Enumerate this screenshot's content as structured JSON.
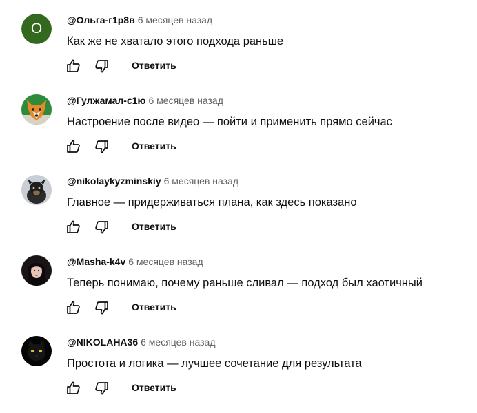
{
  "comments": [
    {
      "author": "@Ольга-г1р8в",
      "time": "6 месяцев назад",
      "text": "Как же не хватало этого подхода раньше",
      "avatar_letter": "О",
      "avatar_color": "#33691e",
      "reply_label": "Ответить"
    },
    {
      "author": "@Гулжамал-с1ю",
      "time": "6 месяцев назад",
      "text": "Настроение после видео — пойти и применить прямо сейчас",
      "reply_label": "Ответить"
    },
    {
      "author": "@nikolaykyzminskiy",
      "time": "6 месяцев назад",
      "text": "Главное — придерживаться плана, как здесь показано",
      "reply_label": "Ответить"
    },
    {
      "author": "@Masha-k4v",
      "time": "6 месяцев назад",
      "text": "Теперь понимаю, почему раньше сливал — подход был хаотичный",
      "reply_label": "Ответить"
    },
    {
      "author": "@NIKOLAHA36",
      "time": "6 месяцев назад",
      "text": "Простота и логика — лучшее сочетание для результата",
      "reply_label": "Ответить"
    }
  ],
  "icons": {
    "like": "thumbs-up-icon",
    "dislike": "thumbs-down-icon"
  }
}
